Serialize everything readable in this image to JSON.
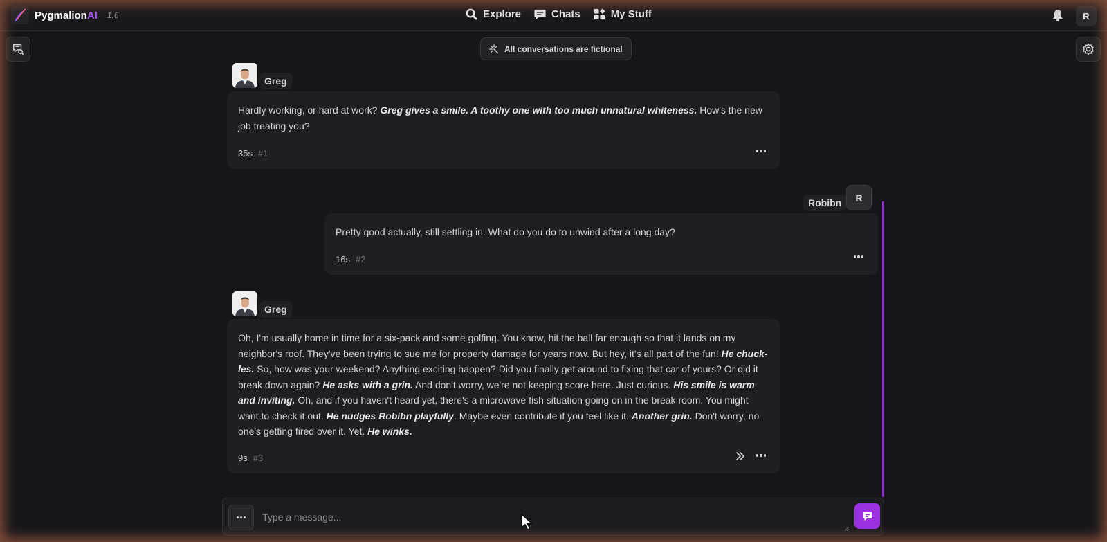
{
  "brand": {
    "name": "Pygmalion",
    "name_accent": "AI",
    "version": "1.6"
  },
  "nav": [
    {
      "label": "Explore",
      "icon": "search-icon"
    },
    {
      "label": "Chats",
      "icon": "chat-bubble-icon"
    },
    {
      "label": "My Stuff",
      "icon": "grid-icon"
    }
  ],
  "user": {
    "initial": "R"
  },
  "banner": {
    "text": "All conversations are fictional",
    "icon": "sparkle-icon"
  },
  "colors": {
    "accent": "#9b30e0",
    "background": "#16161a",
    "bubble": "#1f1f23"
  },
  "messages": [
    {
      "author": "Greg",
      "segments": [
        {
          "text": "Hardly working, or hard at work? ",
          "em": false
        },
        {
          "text": "Greg gives a smile. A toothy one with too much unnatural whiteness.",
          "em": true
        },
        {
          "text": " How's the new job treating you?",
          "em": false
        }
      ],
      "time": "35s",
      "index": "#1"
    },
    {
      "author": "Robibn",
      "avatar_initial": "R",
      "segments": [
        {
          "text": "Pretty good actually, still settling in. What do you do to unwind after a long day?",
          "em": false
        }
      ],
      "time": "16s",
      "index": "#2"
    },
    {
      "author": "Greg",
      "segments": [
        {
          "text": "Oh, I'm usually home in time for a six-pack and some golfing. You know, hit the ball far enough so that it lands on my neighbor's roof. They've been trying to sue me for property damage for years now. But hey, it's all part of the fun! ",
          "em": false
        },
        {
          "text": "He chuck-les.",
          "em": true
        },
        {
          "text": " So, how was your weekend? Anything exciting happen? Did you finally get around to fixing that car of yours? Or did it break down again? ",
          "em": false
        },
        {
          "text": "He asks with a grin.",
          "em": true
        },
        {
          "text": " And don't worry, we're not keeping score here. Just curious. ",
          "em": false
        },
        {
          "text": "His smile is warm and inviting.",
          "em": true
        },
        {
          "text": " Oh, and if you haven't heard yet, there's a microwave fish situation going on in the break room. You might want to check it out. ",
          "em": false
        },
        {
          "text": "He nudges Robibn playfully",
          "em": true
        },
        {
          "text": ". Maybe even contribute if you feel like it. ",
          "em": false
        },
        {
          "text": "Another grin.",
          "em": true
        },
        {
          "text": " Don't worry, no one's getting fired over it. Yet. ",
          "em": false
        },
        {
          "text": "He winks.",
          "em": true
        }
      ],
      "time": "9s",
      "index": "#3"
    }
  ],
  "composer": {
    "placeholder": "Type a message..."
  }
}
